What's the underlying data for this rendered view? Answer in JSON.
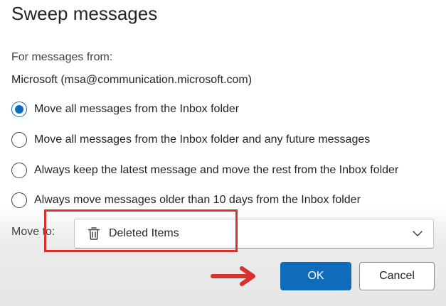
{
  "dialog": {
    "title": "Sweep messages",
    "from_label": "For messages from:",
    "sender": "Microsoft (msa@communication.microsoft.com)"
  },
  "options": [
    {
      "label": "Move all messages from the Inbox folder",
      "checked": true
    },
    {
      "label": "Move all messages from the Inbox folder and any future messages",
      "checked": false
    },
    {
      "label": "Always keep the latest message and move the rest from the Inbox folder",
      "checked": false
    },
    {
      "label": "Always move messages older than 10 days from the Inbox folder",
      "checked": false
    }
  ],
  "move_to": {
    "label": "Move to:",
    "selected": "Deleted Items",
    "icon": "trash-icon"
  },
  "buttons": {
    "ok": "OK",
    "cancel": "Cancel"
  },
  "colors": {
    "accent": "#0f6cbd",
    "annotation": "#d9322c"
  }
}
